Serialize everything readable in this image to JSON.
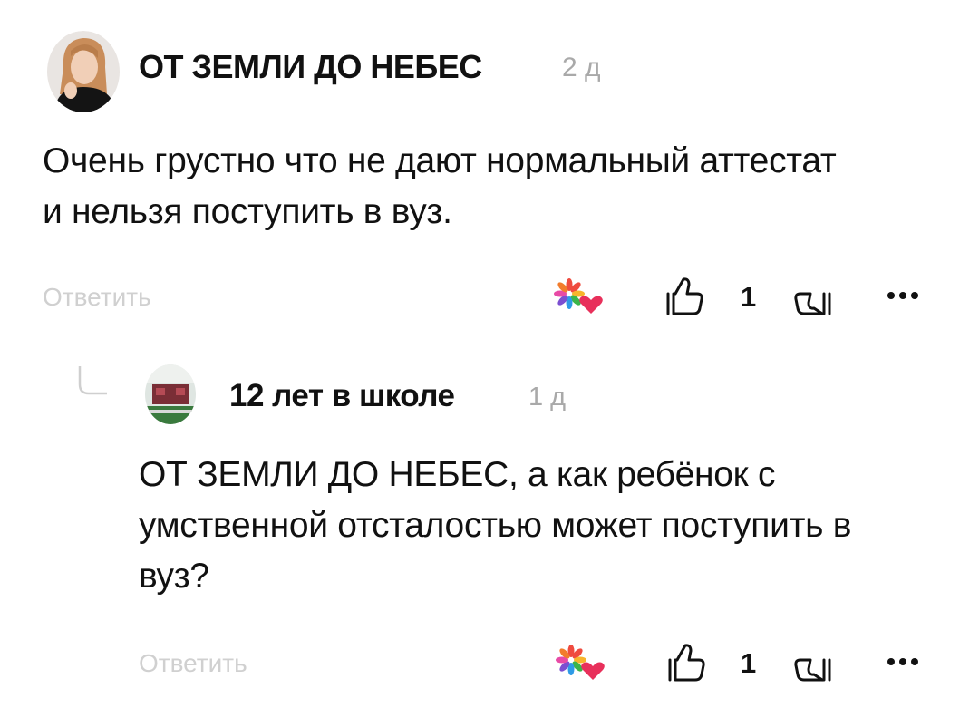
{
  "comments": [
    {
      "author": "ОТ ЗЕМЛИ ДО НЕБЕС",
      "time": "2 д",
      "text": "Очень грустно что не дают нормальный аттестат и нельзя поступить в вуз.",
      "reply_label": "Ответить",
      "likes": "1",
      "avatar_icon": "woman-portrait-avatar",
      "reaction_icon": "flower-heart-reaction-icon"
    },
    {
      "author": "12 лет в школе",
      "time": "1 д",
      "text": "ОТ ЗЕМЛИ ДО НЕБЕС, а как ребёнок с умственной отсталостью может поступить в вуз?",
      "reply_label": "Ответить",
      "likes": "1",
      "avatar_icon": "classroom-avatar",
      "reaction_icon": "flower-heart-reaction-icon"
    }
  ],
  "colors": {
    "text": "#111111",
    "muted": "#a9a9a9",
    "reply": "#d0d0d0",
    "heart": "#e8305b"
  }
}
